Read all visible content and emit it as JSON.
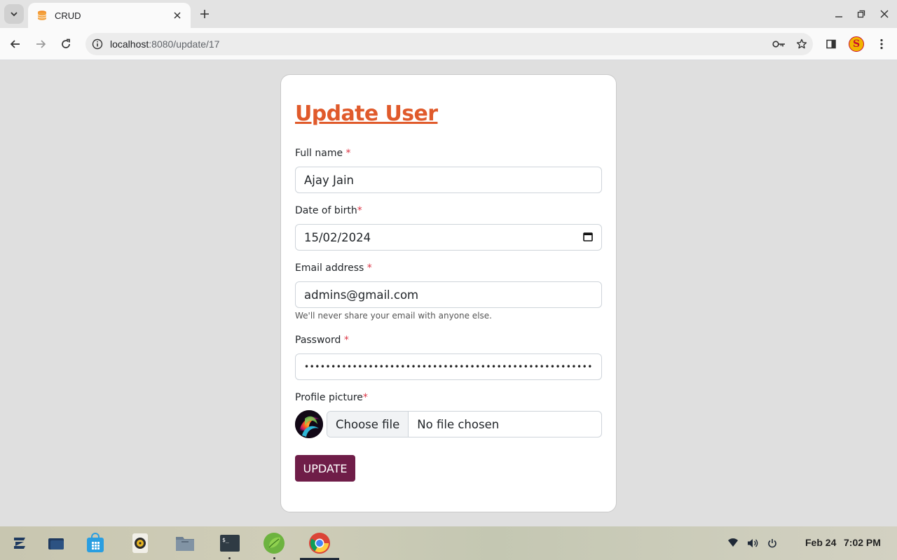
{
  "browser": {
    "tab_title": "CRUD",
    "url_host": "localhost",
    "url_path": ":8080/update/17"
  },
  "form": {
    "title": "Update User",
    "required_marker": "*",
    "full_name": {
      "label": "Full name ",
      "value": "Ajay Jain"
    },
    "dob": {
      "label": "Date of birth",
      "value": "15/02/2024"
    },
    "email": {
      "label": "Email address ",
      "value": "admins@gmail.com",
      "help": "We'll never share your email with anyone else."
    },
    "password": {
      "label": "Password ",
      "value": "•••••••••••••••••••••••••••••••••••••••••••••••••••••••"
    },
    "profile_picture": {
      "label": "Profile picture",
      "choose_label": "Choose file",
      "status": "No file chosen"
    },
    "submit_label": "UPDATE"
  },
  "taskbar": {
    "date": "Feb 24",
    "time": "7:02 PM"
  },
  "colors": {
    "title_accent": "#e05a2b",
    "submit_bg": "#6f1d48",
    "required": "#dc3545"
  },
  "icons": [
    "tab-search-icon",
    "database-favicon-icon",
    "close-icon",
    "plus-icon",
    "minimize-icon",
    "restore-icon",
    "back-icon",
    "forward-icon",
    "reload-icon",
    "site-info-icon",
    "key-icon",
    "star-icon",
    "side-panel-icon",
    "menu-icon",
    "calendar-icon",
    "zorin-icon",
    "files-icon",
    "store-icon",
    "music-icon",
    "folder-icon",
    "terminal-icon",
    "spring-icon",
    "chrome-icon",
    "wifi-icon",
    "volume-icon",
    "power-icon"
  ]
}
